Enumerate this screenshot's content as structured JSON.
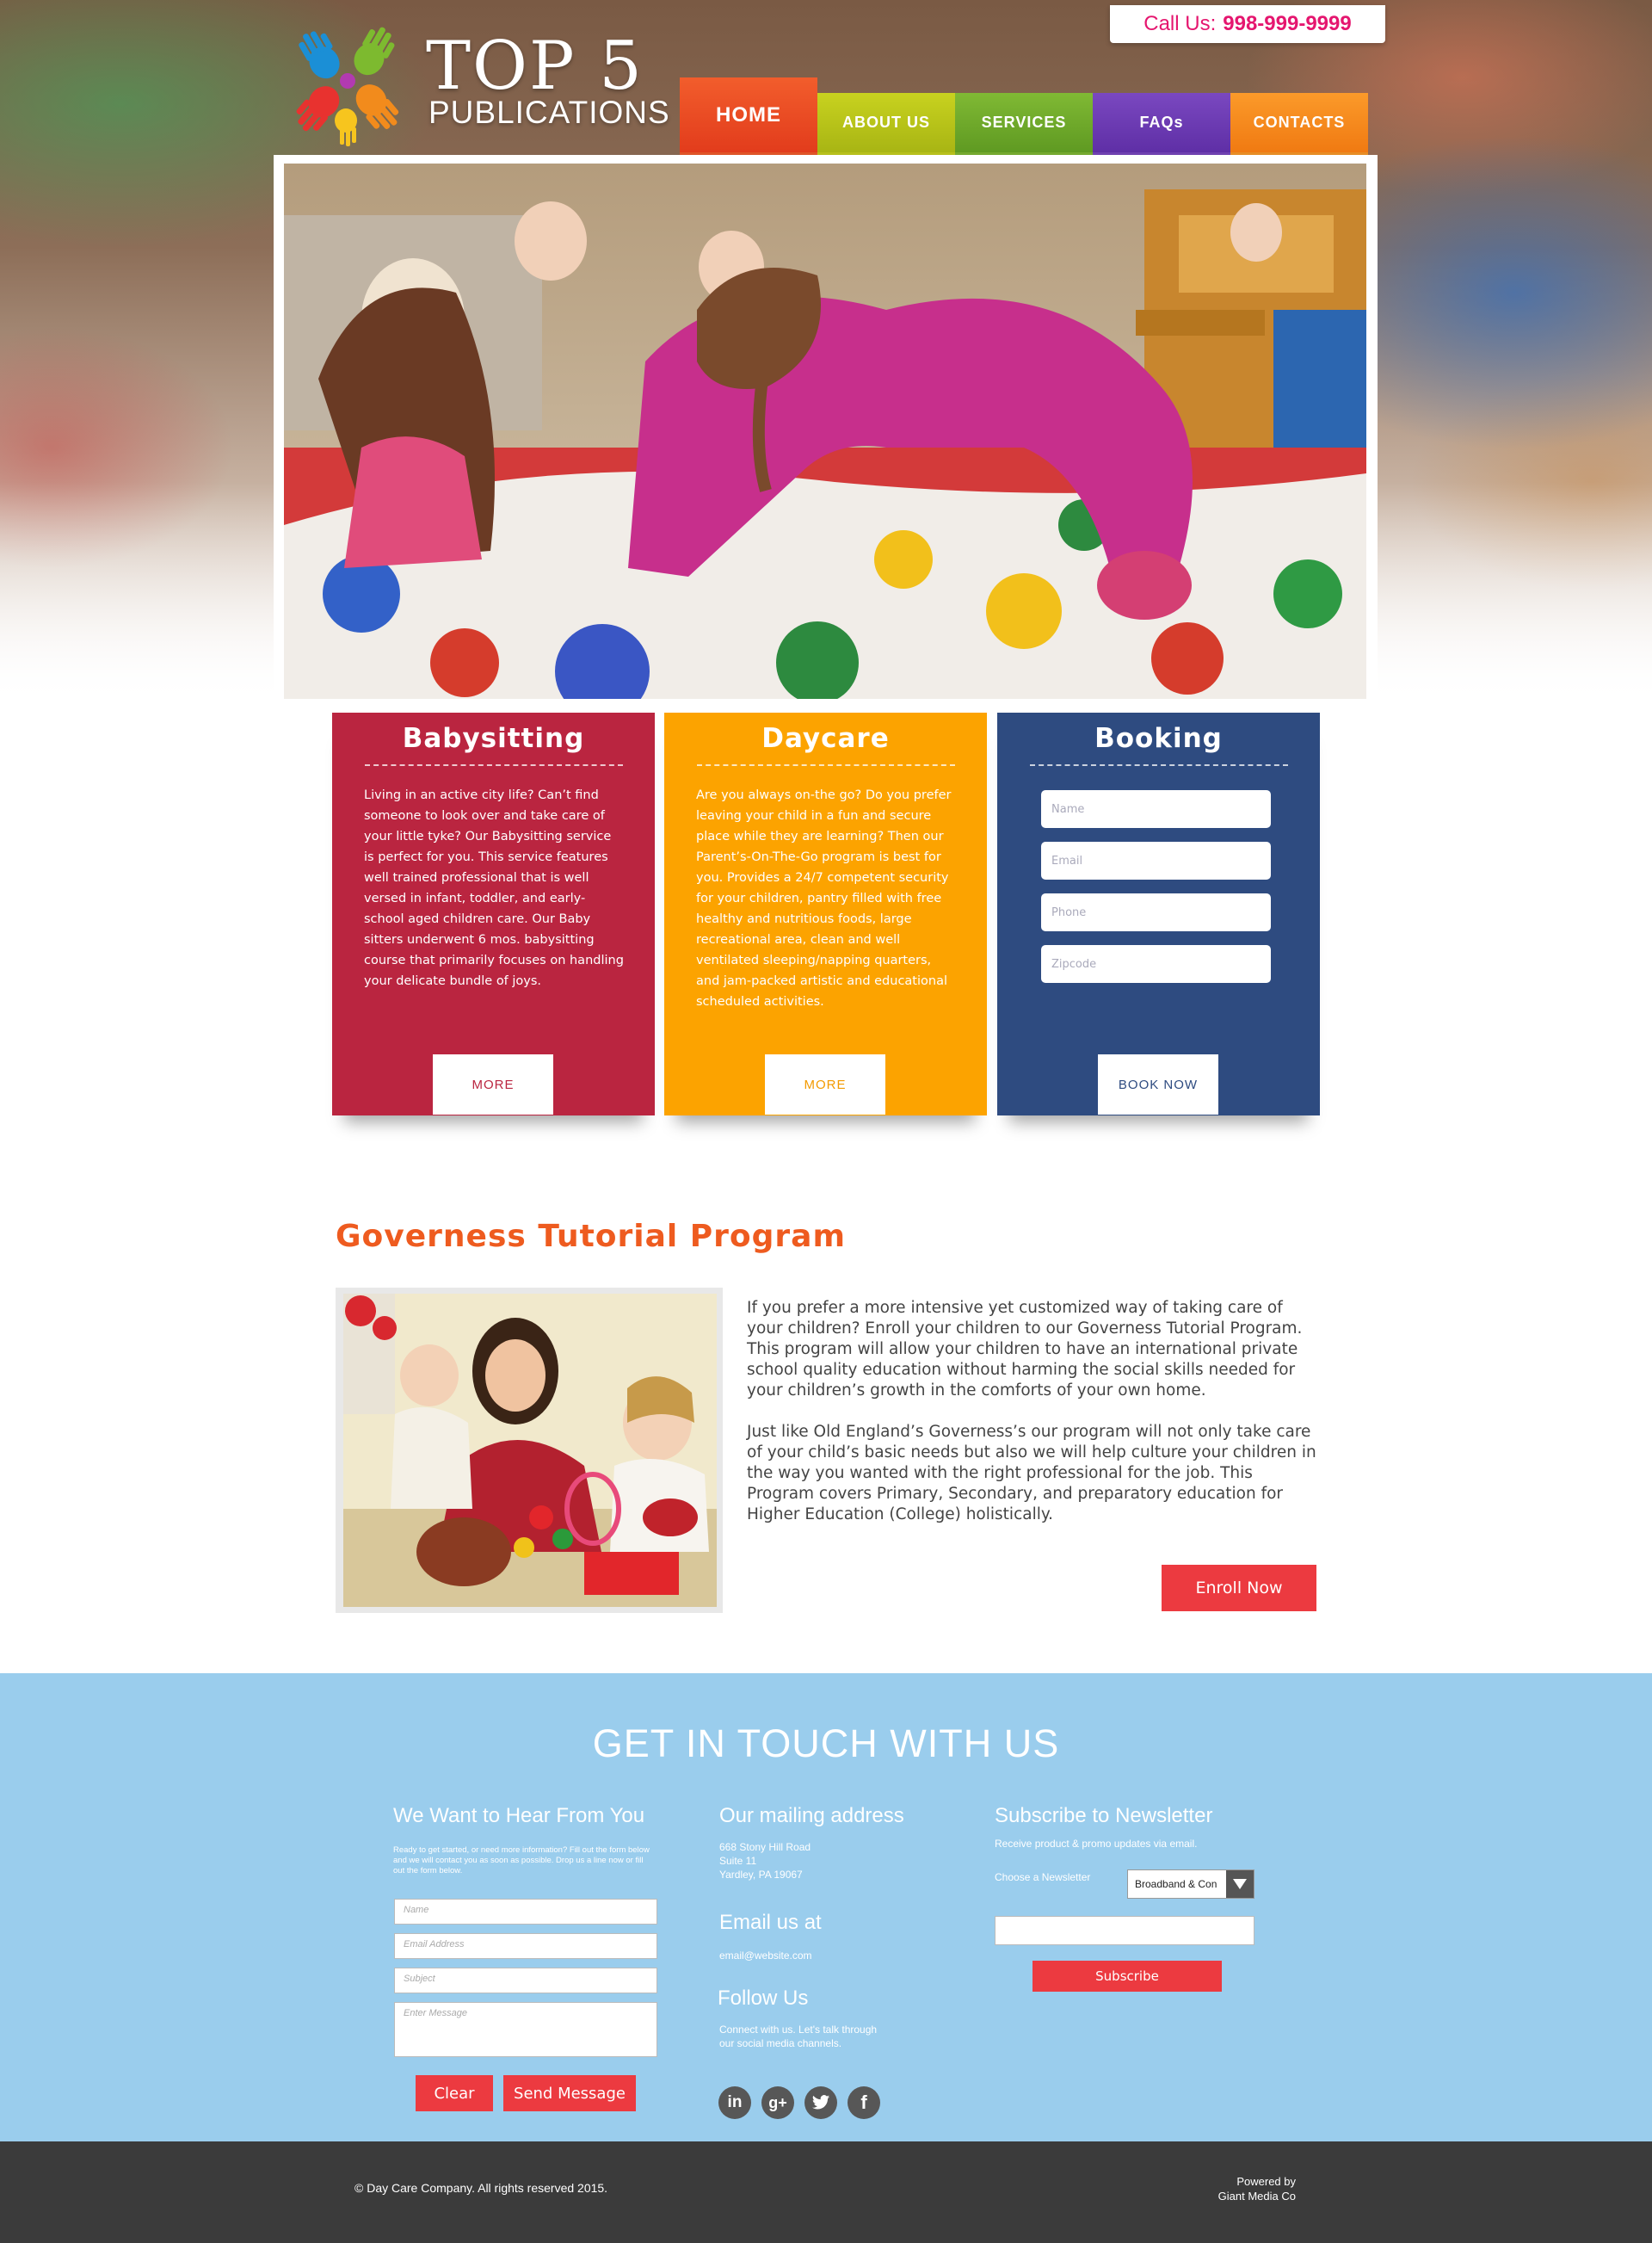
{
  "header": {
    "call_label": "Call Us:",
    "call_number": "998-999-9999",
    "logo_title": "TOP 5",
    "logo_subtitle": "PUBLICATIONS"
  },
  "nav": {
    "items": [
      {
        "label": "HOME",
        "color": "#ee4a23"
      },
      {
        "label": "ABOUT US",
        "color": "#b5c11b"
      },
      {
        "label": "SERVICES",
        "color": "#6da82b"
      },
      {
        "label": "FAQs",
        "color": "#6b3ab3"
      },
      {
        "label": "CONTACTS",
        "color": "#f58a1f"
      }
    ]
  },
  "features": {
    "babysitting": {
      "title": "Babysitting",
      "text": "Living in an active city life? Can’t find someone to look over and take care of your little tyke? Our Babysitting service is perfect for you. This service features well trained professional that is well versed in infant, toddler, and early-school aged children care. Our Baby sitters underwent 6 mos. babysitting course that primarily focuses on handling your delicate bundle of joys.",
      "button": "MORE",
      "color": "#ba2540"
    },
    "daycare": {
      "title": "Daycare",
      "text": "Are you always on-the go? Do you prefer leaving your child in a fun and secure place while they are learning? Then our Parent’s-On-The-Go program is best for you. Provides a 24/7 competent security for your children, pantry filled with free healthy and nutritious foods, large recreational area, clean and well ventilated sleeping/napping quarters, and jam-packed artistic and educational scheduled activities.",
      "button": "MORE",
      "color": "#fca300"
    },
    "booking": {
      "title": "Booking",
      "fields": [
        "Name",
        "Email",
        "Phone",
        "Zipcode"
      ],
      "button": "BOOK NOW",
      "color": "#2e4b80"
    }
  },
  "governess": {
    "title": "Governess Tutorial Program",
    "paragraph1": "If you prefer a more intensive yet customized way of taking care of your children?  Enroll your children to our Governess Tutorial Program. This program will allow your children to have an international private school quality education without harming the social skills needed for your children’s growth in the comforts of your own home.",
    "paragraph2": "Just like Old England’s Governess’s our program will not only take care of your child’s basic needs but also we will help culture your children in the way you wanted with the right professional for the job. This Program covers Primary, Secondary, and preparatory education for Higher Education (College) holistically.",
    "button": "Enroll Now"
  },
  "contact": {
    "title": "GET IN TOUCH WITH US",
    "hear": {
      "heading": "We Want to Hear From You",
      "intro": "Ready to get started, or need more information? Fill out the form below and we will contact you as soon as possible. Drop us a line now or fill out the form below.",
      "fields": [
        "Name",
        "Email Address",
        "Subject",
        "Enter Message"
      ],
      "clear": "Clear",
      "send": "Send Message"
    },
    "mailing": {
      "heading": "Our mailing address",
      "line1": "668 Stony Hill Road",
      "line2": "Suite 11",
      "line3": "Yardley, PA 19067"
    },
    "email": {
      "heading": "Email us at",
      "address": "email@website.com"
    },
    "follow": {
      "heading": "Follow Us",
      "text": "Connect with us. Let's talk through our social media channels.",
      "icons": [
        "linkedin-icon",
        "google-plus-icon",
        "twitter-icon",
        "facebook-icon"
      ]
    },
    "newsletter": {
      "heading": "Subscribe to Newsletter",
      "subtext": "Receive product & promo updates via email.",
      "choose_label": "Choose a Newsletter",
      "selected": "Broadband & Con",
      "button": "Subscribe"
    }
  },
  "footer": {
    "copyright": "© Day Care Company. All rights reserved 2015.",
    "powered_line1": "Powered by",
    "powered_line2": "Giant Media Co"
  }
}
